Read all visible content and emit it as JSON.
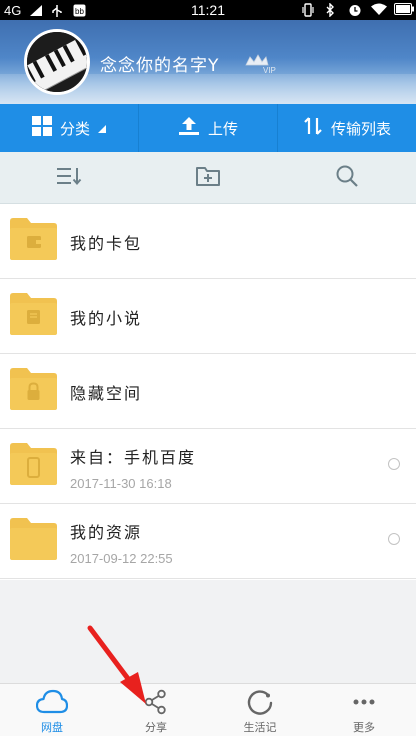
{
  "status_bar": {
    "network": "4G",
    "time": "11:21"
  },
  "profile": {
    "username": "念念你的名字Y",
    "vip_label": "VIP"
  },
  "action_bar": [
    {
      "label": "分类",
      "icon": "grid-icon"
    },
    {
      "label": "上传",
      "icon": "upload-icon"
    },
    {
      "label": "传输列表",
      "icon": "transfer-icon"
    }
  ],
  "toolbar": [
    {
      "icon": "sort-icon"
    },
    {
      "icon": "new-folder-icon"
    },
    {
      "icon": "search-icon"
    }
  ],
  "files": [
    {
      "name": "我的卡包",
      "date": "",
      "icon": "wallet-folder-icon"
    },
    {
      "name": "我的小说",
      "date": "",
      "icon": "book-folder-icon"
    },
    {
      "name": "隐藏空间",
      "date": "",
      "icon": "lock-folder-icon"
    },
    {
      "name": "来自：手机百度",
      "date": "2017-11-30  16:18",
      "icon": "phone-folder-icon"
    },
    {
      "name": "我的资源",
      "date": "2017-09-12  22:55",
      "icon": "folder-icon"
    }
  ],
  "bottom_nav": [
    {
      "label": "网盘",
      "icon": "cloud-icon",
      "active": true
    },
    {
      "label": "分享",
      "icon": "share-icon",
      "active": false
    },
    {
      "label": "生活记",
      "icon": "circle-refresh-icon",
      "active": false
    },
    {
      "label": "更多",
      "icon": "more-icon",
      "active": false
    }
  ],
  "colors": {
    "accent": "#1f8ee6",
    "folder": "#f1c250",
    "annotation": "#e8211e"
  }
}
